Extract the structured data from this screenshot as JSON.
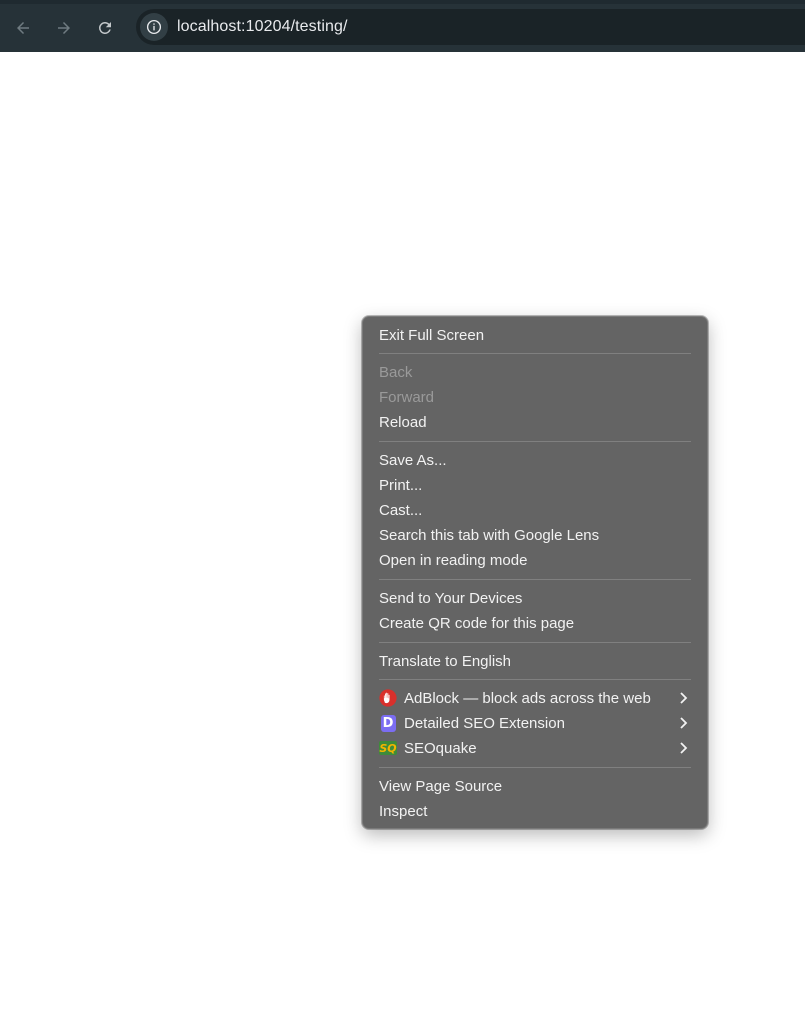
{
  "browser": {
    "url": "localhost:10204/testing/",
    "colors": {
      "toolbar": "#263238",
      "omnibox": "#1a2327",
      "icon": "#9aa0a6"
    },
    "icons": {
      "back": "arrow-left",
      "forward": "arrow-right",
      "reload": "reload",
      "site_info": "info-circle"
    }
  },
  "context_menu": {
    "colors": {
      "background": "#646464",
      "text": "#f2f2f2",
      "disabled_text": "#9a9a9a"
    },
    "items": {
      "exit_full_screen": "Exit Full Screen",
      "back": "Back",
      "forward": "Forward",
      "reload": "Reload",
      "save_as": "Save As...",
      "print": "Print...",
      "cast": "Cast...",
      "search_google_lens": "Search this tab with Google Lens",
      "reading_mode": "Open in reading mode",
      "send_to_devices": "Send to Your Devices",
      "create_qr": "Create QR code for this page",
      "translate": "Translate to English",
      "adblock": "AdBlock — block ads across the web",
      "detailed_seo": "Detailed SEO Extension",
      "seoquake": "SEOquake",
      "view_source": "View Page Source",
      "inspect": "Inspect"
    },
    "extension_icons": {
      "adblock": "adblock-hand-icon",
      "detailed_seo": "detailed-seo-d-icon",
      "seoquake": "seoquake-sq-icon"
    },
    "extension_icon_text": {
      "detailed_seo": "D",
      "seoquake": "SQ"
    }
  }
}
